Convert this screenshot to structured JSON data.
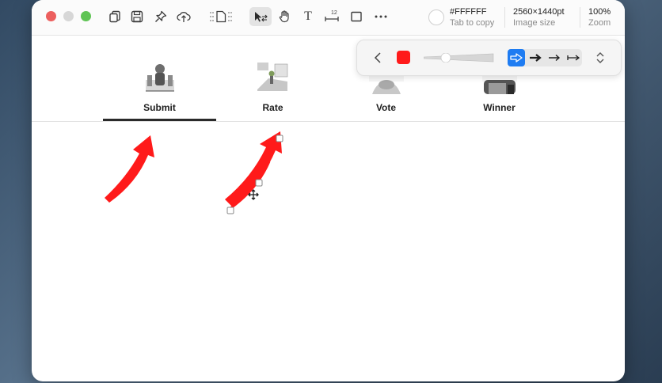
{
  "window": {
    "toolbar": {
      "icons": [
        "copy-icon",
        "save-icon",
        "pin-icon",
        "upload-cloud-icon",
        "page-layout-icon",
        "select-arrow-icon",
        "hand-icon",
        "text-icon",
        "measure-icon",
        "rectangle-icon",
        "more-icon"
      ],
      "color_hex": "#FFFFFF",
      "color_hint": "Tab to copy",
      "image_size": "2560×1440pt",
      "image_size_label": "Image size",
      "zoom": "100%",
      "zoom_label": "Zoom",
      "measure_badge": "12"
    },
    "tabs": [
      {
        "label": "Submit",
        "active": true
      },
      {
        "label": "Rate",
        "active": false
      },
      {
        "label": "Vote",
        "active": false
      },
      {
        "label": "Winner",
        "active": false
      }
    ],
    "arrow_popover": {
      "stroke_color": "#FF1A1A",
      "arrow_styles": [
        "hollow-arrow",
        "bold-arrow",
        "thin-arrow",
        "double-arrow"
      ],
      "selected_style": "hollow-arrow"
    },
    "annotations": [
      {
        "type": "arrow",
        "color": "#FF1A1A"
      },
      {
        "type": "arrow",
        "color": "#FF1A1A",
        "selected": true
      }
    ]
  },
  "colors": {
    "accent_blue": "#1E7CF2",
    "arrow_red": "#FF1A1A",
    "close": "#EC5F5E",
    "minimize": "#D7D7D7",
    "zoom": "#5FC454"
  }
}
